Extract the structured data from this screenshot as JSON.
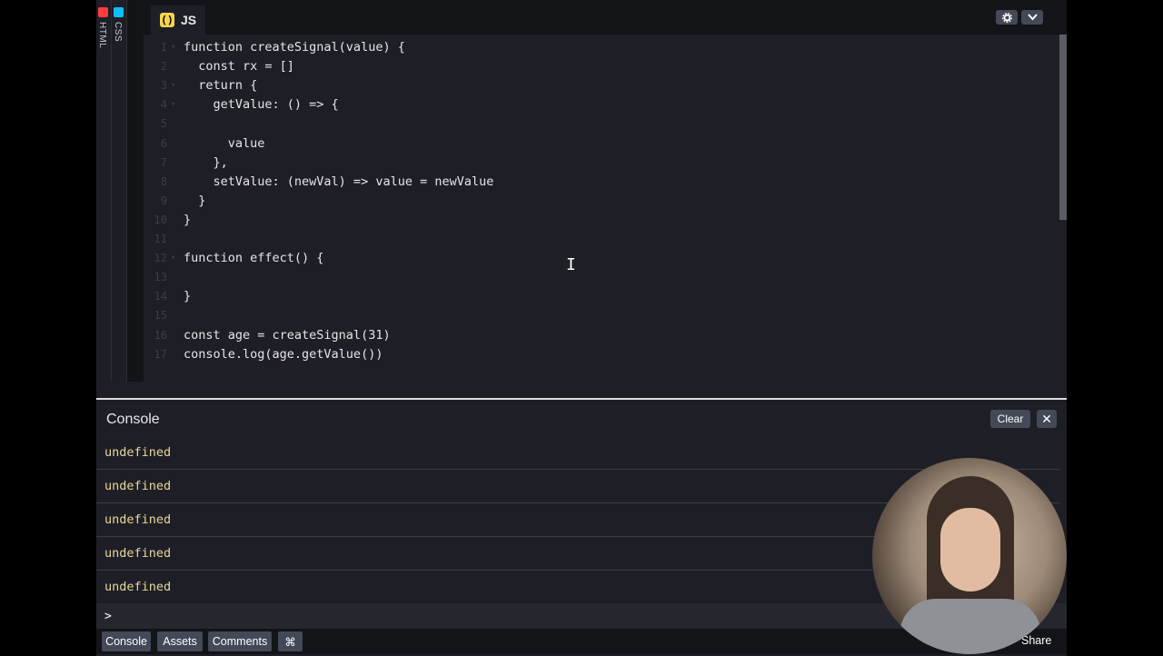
{
  "side_panels": [
    {
      "label": "HTML",
      "badge_color": "#ff3c41"
    },
    {
      "label": "CSS",
      "badge_color": "#0ebeff"
    }
  ],
  "editor": {
    "tab_label": "JS",
    "tab_badge": "( )",
    "settings_icon": "gear-icon",
    "collapse_icon": "chevron-down-icon",
    "lines": [
      {
        "n": "1",
        "fold": true,
        "text": "function createSignal(value) {"
      },
      {
        "n": "2",
        "fold": false,
        "text": "  const rx = []"
      },
      {
        "n": "3",
        "fold": true,
        "text": "  return {"
      },
      {
        "n": "4",
        "fold": true,
        "text": "    getValue: () => {"
      },
      {
        "n": "5",
        "fold": false,
        "text": ""
      },
      {
        "n": "6",
        "fold": false,
        "text": "      value"
      },
      {
        "n": "7",
        "fold": false,
        "text": "    },"
      },
      {
        "n": "8",
        "fold": false,
        "text": "    setValue: (newVal) => value = newValue"
      },
      {
        "n": "9",
        "fold": false,
        "text": "  }"
      },
      {
        "n": "10",
        "fold": false,
        "text": "}"
      },
      {
        "n": "11",
        "fold": false,
        "text": ""
      },
      {
        "n": "12",
        "fold": true,
        "text": "function effect() {"
      },
      {
        "n": "13",
        "fold": false,
        "text": ""
      },
      {
        "n": "14",
        "fold": false,
        "text": "}"
      },
      {
        "n": "15",
        "fold": false,
        "text": ""
      },
      {
        "n": "16",
        "fold": false,
        "text": "const age = createSignal(31)"
      },
      {
        "n": "17",
        "fold": false,
        "text": "console.log(age.getValue())"
      }
    ]
  },
  "console": {
    "title": "Console",
    "clear_label": "Clear",
    "close_label": "✕",
    "logs": [
      "undefined",
      "undefined",
      "undefined",
      "undefined",
      "undefined"
    ],
    "prompt": ">"
  },
  "footer": {
    "buttons": [
      "Console",
      "Assets",
      "Comments",
      "⌘"
    ],
    "share_label": "Share"
  }
}
